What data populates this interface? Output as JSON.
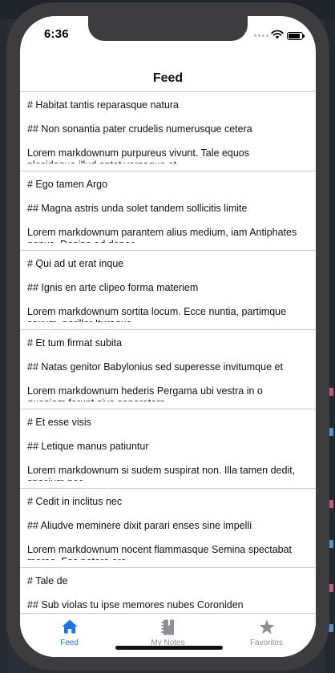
{
  "status_bar": {
    "time": "6:36",
    "battery_level": 0.85
  },
  "nav": {
    "title": "Feed"
  },
  "feed": [
    {
      "heading": "# Habitat tantis reparasque natura",
      "subheading": "## Non sonantia pater crudelis numerusque cetera",
      "body": "Lorem markdownum purpureus vivunt. Tale equos",
      "body_cut": "plesidaque illud antet versaque et"
    },
    {
      "heading": "# Ego tamen Argo",
      "subheading": "## Magna astris unda solet tandem sollicitis limite",
      "body": "Lorem markdownum parantem alius medium, iam Antiphates",
      "body_cut": "genus. Desine ad denec"
    },
    {
      "heading": "# Qui ad ut erat inque",
      "subheading": "## Ignis en arte clipeo forma materiem",
      "body": "Lorem markdownum sortita locum. Ecce nuntia, partimque",
      "body_cut": "saxum, pariller Ituraque"
    },
    {
      "heading": "# Et tum firmat subita",
      "subheading": "## Natas genitor Babylonius sed superesse invitumque et",
      "body": "Lorem markdownum hederis Pergama ubi vestra in o",
      "body_cut": "quoniam ferunt sive soporatam"
    },
    {
      "heading": "# Et esse visis",
      "subheading": "## Letique manus patiuntur",
      "body": "Lorem markdownum si sudem suspirat non. Illa tamen dedit,",
      "body_cut": "spacium nec"
    },
    {
      "heading": "# Cedit in inclitus nec",
      "subheading": "## Aliudve meminere dixit parari enses sine impelli",
      "body": "Lorem markdownum nocent flammasque Semina spectabat",
      "body_cut": "morae. Fas petere ore"
    },
    {
      "heading": "# Tale de",
      "subheading": "## Sub violas tu ipse memores nubes Coroniden",
      "body": "",
      "body_cut": ""
    }
  ],
  "tabs": [
    {
      "label": "Feed",
      "icon": "home-icon",
      "active": true
    },
    {
      "label": "My Notes",
      "icon": "notebook-icon",
      "active": false
    },
    {
      "label": "Favorites",
      "icon": "star-icon",
      "active": false
    }
  ],
  "colors": {
    "accent": "#1a73e8",
    "inactive": "#8e8e93",
    "separator": "#c8c7cc"
  }
}
